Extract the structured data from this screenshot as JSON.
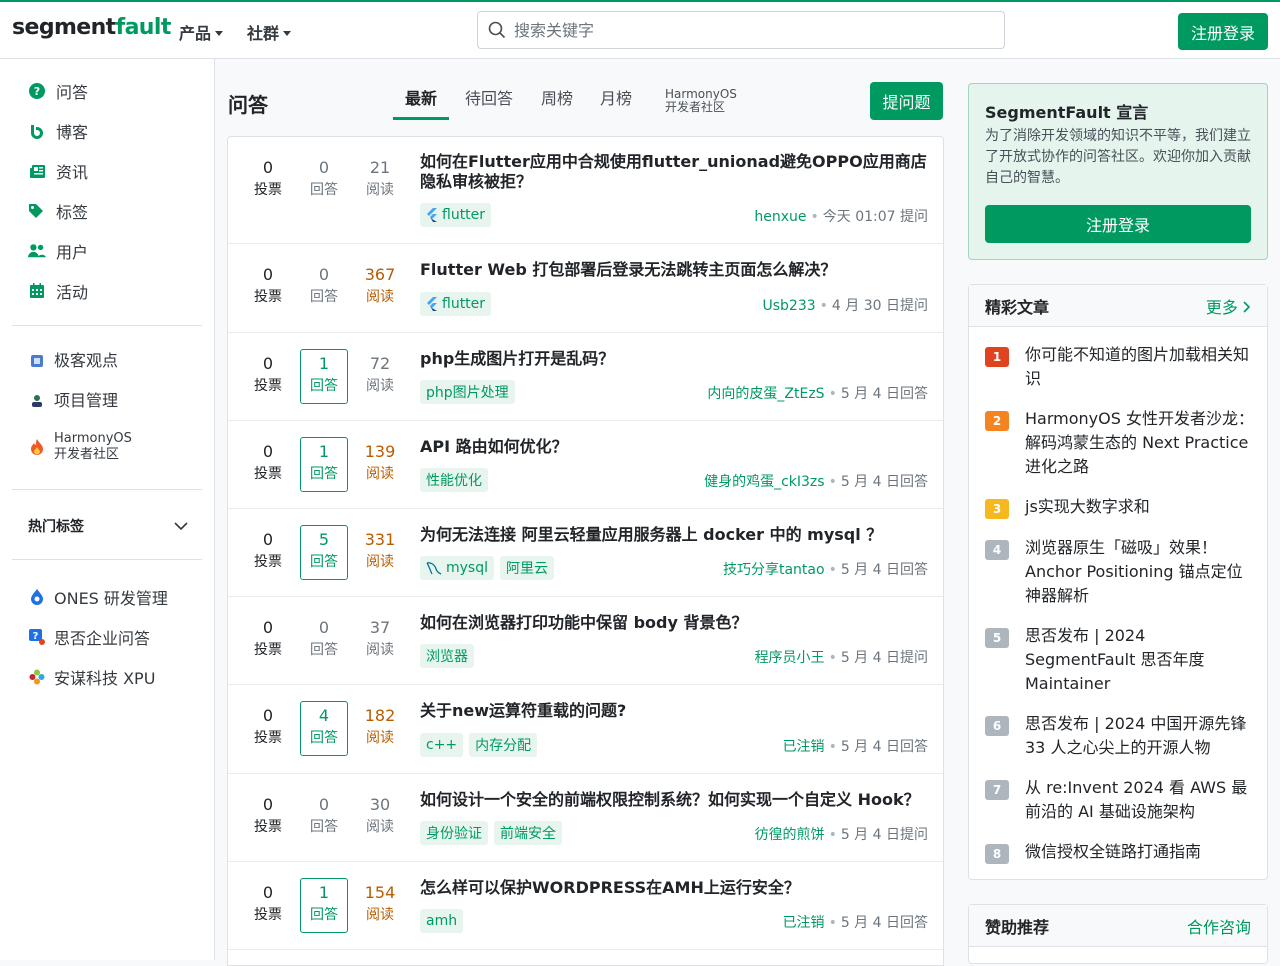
{
  "header": {
    "logo_part1": "segment",
    "logo_part2": "fault",
    "nav_product": "产品",
    "nav_community": "社群",
    "search_placeholder": "搜索关键字",
    "login_label": "注册登录"
  },
  "sidebar": {
    "items": [
      {
        "label": "问答",
        "icon": "question-circle-icon"
      },
      {
        "label": "博客",
        "icon": "blog-icon"
      },
      {
        "label": "资讯",
        "icon": "newspaper-icon"
      },
      {
        "label": "标签",
        "icon": "tags-icon"
      },
      {
        "label": "用户",
        "icon": "users-icon"
      },
      {
        "label": "活动",
        "icon": "calendar-icon"
      }
    ],
    "extra": [
      {
        "label": "极客观点",
        "icon": "geek-icon"
      },
      {
        "label": "项目管理",
        "icon": "project-icon"
      },
      {
        "label": "HarmonyOS\n开发者社区",
        "icon": "fire-icon"
      }
    ],
    "hot_tags": "热门标签",
    "partners": [
      {
        "label": "ONES 研发管理",
        "icon": "ones-icon"
      },
      {
        "label": "思否企业问答",
        "icon": "company-qa-icon"
      },
      {
        "label": "安谋科技 XPU",
        "icon": "xpu-icon"
      }
    ]
  },
  "main": {
    "title": "问答",
    "tabs": [
      "最新",
      "待回答",
      "周榜",
      "月榜",
      "HarmonyOS\n开发者社区"
    ],
    "ask_label": "提问题",
    "vote_label": "投票",
    "answer_label": "回答",
    "view_label": "阅读",
    "questions": [
      {
        "votes": "0",
        "answers": "0",
        "views": "21",
        "title": "如何在Flutter应用中合规使用flutter_unionad避免OPPO应用商店隐私审核被拒？",
        "tags": [
          "flutter"
        ],
        "author": "henxue",
        "time": "今天 01:07 提问"
      },
      {
        "votes": "0",
        "answers": "0",
        "views": "367",
        "title": "Flutter Web 打包部署后登录无法跳转主页面怎么解决？",
        "tags": [
          "flutter"
        ],
        "author": "Usb233",
        "time": "4 月 30 日提问"
      },
      {
        "votes": "0",
        "answers": "1",
        "views": "72",
        "title": "php生成图片打开是乱码？",
        "tags": [
          "php图片处理"
        ],
        "author": "内向的皮蛋_ZtEzS",
        "time": "5 月 4 日回答"
      },
      {
        "votes": "0",
        "answers": "1",
        "views": "139",
        "title": "API 路由如何优化？",
        "tags": [
          "性能优化"
        ],
        "author": "健身的鸡蛋_ckI3zs",
        "time": "5 月 4 日回答"
      },
      {
        "votes": "0",
        "answers": "5",
        "views": "331",
        "title": "为何无法连接 阿里云轻量应用服务器上 docker 中的 mysql ？",
        "tags": [
          "mysql",
          "阿里云"
        ],
        "author": "技巧分享tantao",
        "time": "5 月 4 日回答"
      },
      {
        "votes": "0",
        "answers": "0",
        "views": "37",
        "title": "如何在浏览器打印功能中保留 body 背景色？",
        "tags": [
          "浏览器"
        ],
        "author": "程序员小王",
        "time": "5 月 4 日提问"
      },
      {
        "votes": "0",
        "answers": "4",
        "views": "182",
        "title": "关于new运算符重载的问题?",
        "tags": [
          "c++",
          "内存分配"
        ],
        "author": "已注销",
        "time": "5 月 4 日回答"
      },
      {
        "votes": "0",
        "answers": "0",
        "views": "30",
        "title": "如何设计一个安全的前端权限控制系统？如何实现一个自定义 Hook？",
        "tags": [
          "身份验证",
          "前端安全"
        ],
        "author": "彷徨的煎饼",
        "time": "5 月 4 日提问"
      },
      {
        "votes": "0",
        "answers": "1",
        "views": "154",
        "title": "怎么样可以保护WORDPRESS在AMH上运行安全？",
        "tags": [
          "amh"
        ],
        "author": "已注销",
        "time": "5 月 4 日回答"
      }
    ]
  },
  "right": {
    "manifesto_title": "SegmentFault 宣言",
    "manifesto_text": "为了消除开发领域的知识不平等，我们建立了开放式协作的问答社区。欢迎你加入贡献自己的智慧。",
    "manifesto_button": "注册登录",
    "articles_title": "精彩文章",
    "articles_more": "更多",
    "articles": [
      {
        "rank": "1",
        "title": "你可能不知道的图片加载相关知识"
      },
      {
        "rank": "2",
        "title": "HarmonyOS 女性开发者沙龙：解码鸿蒙生态的 Next Practice 进化之路"
      },
      {
        "rank": "3",
        "title": "js实现大数字求和"
      },
      {
        "rank": "4",
        "title": "浏览器原生「磁吸」效果！Anchor Positioning 锚点定位神器解析"
      },
      {
        "rank": "5",
        "title": "思否发布 | 2024 SegmentFault 思否年度 Maintainer"
      },
      {
        "rank": "6",
        "title": "思否发布 | 2024 中国开源先锋 33 人之心尖上的开源人物"
      },
      {
        "rank": "7",
        "title": "从 re:Invent 2024 看 AWS 最前沿的 AI 基础设施架构"
      },
      {
        "rank": "8",
        "title": "微信授权全链路打通指南"
      }
    ],
    "sponsor_title": "赞助推荐",
    "sponsor_link": "合作咨询"
  },
  "colors": {
    "brand": "#009a61",
    "rank1": "#e0431f",
    "rank2": "#f5831f",
    "rank3": "#f5b81f",
    "rank_other": "#adb5bd",
    "hot_views": "#b85c00"
  }
}
